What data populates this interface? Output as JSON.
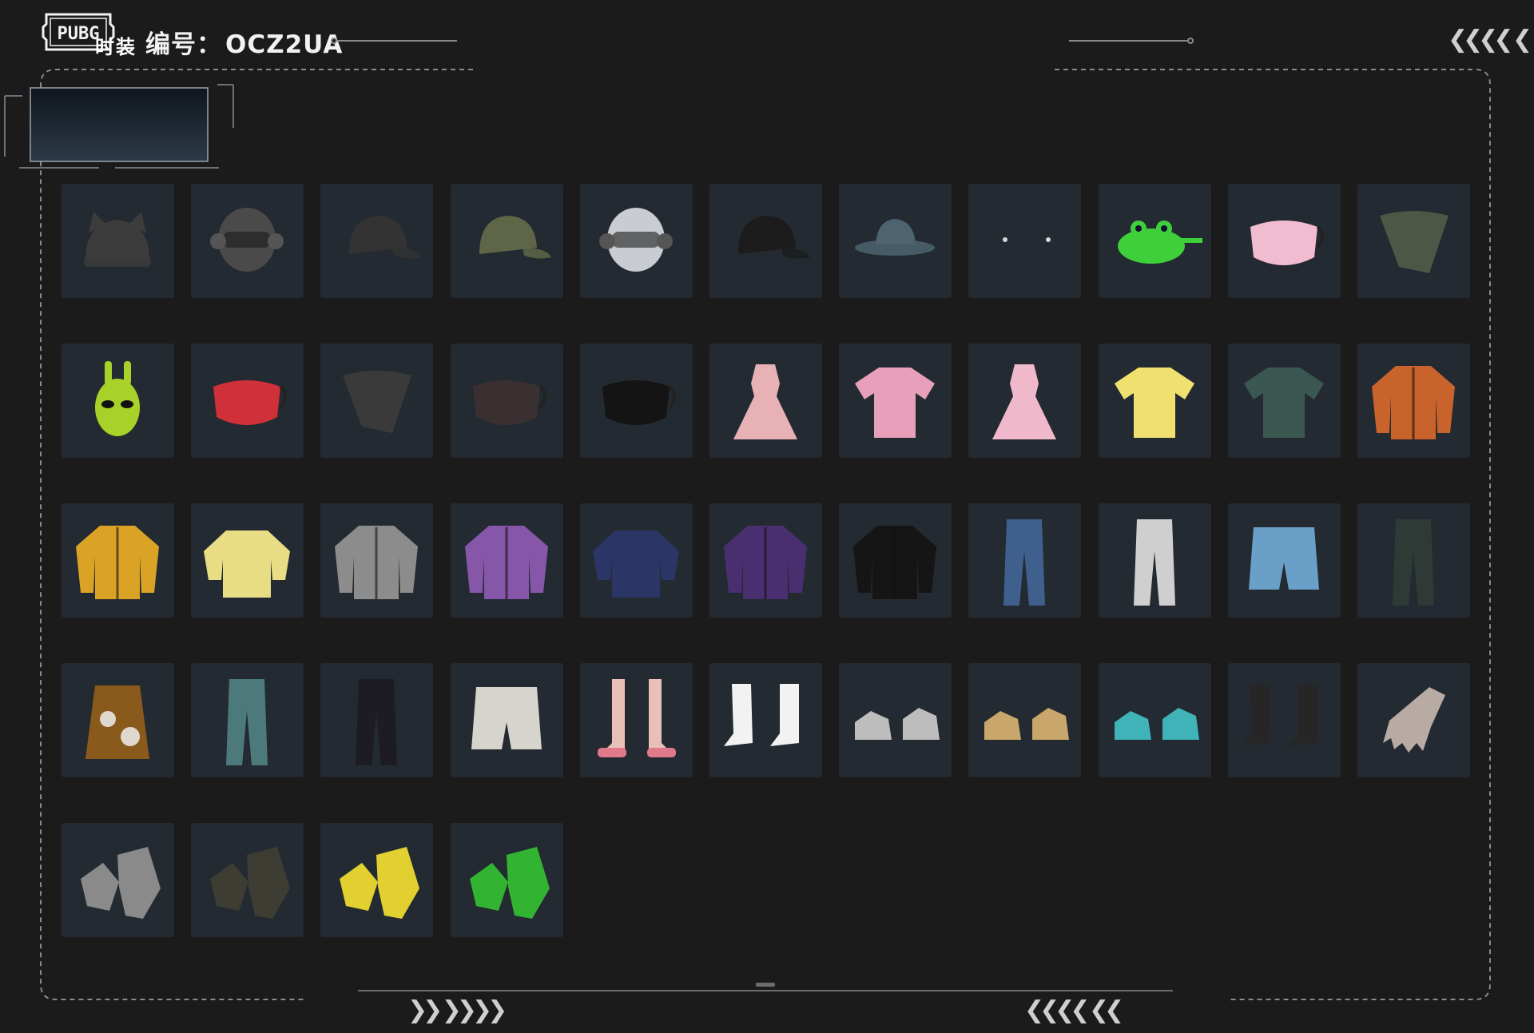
{
  "header": {
    "logo_text": "PUBG",
    "code_label": "编号：",
    "code_value": "OCZ2UA"
  },
  "tabs": [
    {
      "label": "时装",
      "active": true
    }
  ],
  "chevrons": {
    "top_right": "❮❮❮❮ ❮",
    "bottom_left": "❯❯ ❯❯❯❯",
    "bottom_right": "❮❮❮❮ ❮❮"
  },
  "colors": {
    "background": "#1b1b1c",
    "tile": "#232a31",
    "frame_line": "#8a8a8a",
    "text": "#ffffff"
  },
  "items": [
    {
      "name": "grey-cat-ear-beanie",
      "icon": "beanie-icon",
      "color": "#3c3c3c"
    },
    {
      "name": "headphones-dreadlocks-helmet",
      "icon": "helmet-icon",
      "color": "#4a4a4a"
    },
    {
      "name": "black-cap",
      "icon": "cap-icon",
      "color": "#333333"
    },
    {
      "name": "olive-cap-headset",
      "icon": "cap-icon",
      "color": "#5e6647"
    },
    {
      "name": "cyber-mask-helmet",
      "icon": "helmet-icon",
      "color": "#c9ccd0"
    },
    {
      "name": "black-logo-cap",
      "icon": "cap-icon",
      "color": "#1c1c1c"
    },
    {
      "name": "blue-bucket-hat",
      "icon": "hat-icon",
      "color": "#4d6470"
    },
    {
      "name": "eye-dots",
      "icon": "dots-icon",
      "color": "#d8d8d8"
    },
    {
      "name": "green-frog-mask",
      "icon": "frog-icon",
      "color": "#3fcf3a"
    },
    {
      "name": "pink-face-mask",
      "icon": "mask-icon",
      "color": "#f2bcd0"
    },
    {
      "name": "camo-bandana",
      "icon": "bandana-icon",
      "color": "#4c5746"
    },
    {
      "name": "green-alien-mask",
      "icon": "alien-icon",
      "color": "#a8d12a"
    },
    {
      "name": "red-mouth-mask",
      "icon": "mask-icon",
      "color": "#d0303a"
    },
    {
      "name": "grey-scarf",
      "icon": "bandana-icon",
      "color": "#3a3a3a"
    },
    {
      "name": "tactical-face-mask",
      "icon": "mask-icon",
      "color": "#3a3032"
    },
    {
      "name": "shark-teeth-mask",
      "icon": "mask-icon",
      "color": "#141414"
    },
    {
      "name": "pink-ruffle-dress",
      "icon": "dress-icon",
      "color": "#e7b1b6"
    },
    {
      "name": "pink-camo-tee",
      "icon": "shirt-icon",
      "color": "#e8a0ba"
    },
    {
      "name": "pink-qipao-dress",
      "icon": "dress-icon",
      "color": "#f0b8cb"
    },
    {
      "name": "yellow-raglan-tee",
      "icon": "shirt-icon",
      "color": "#f0e070"
    },
    {
      "name": "floral-shirt",
      "icon": "shirt-icon",
      "color": "#3b5752"
    },
    {
      "name": "orange-tech-jacket",
      "icon": "jacket-icon",
      "color": "#c8632b"
    },
    {
      "name": "yellow-hoodie",
      "icon": "jacket-icon",
      "color": "#dba326"
    },
    {
      "name": "cream-fluffy-sweater",
      "icon": "sweater-icon",
      "color": "#e8dc85"
    },
    {
      "name": "grey-orange-jacket",
      "icon": "jacket-icon",
      "color": "#8c8c8c"
    },
    {
      "name": "purple-colorblock-jacket",
      "icon": "jacket-icon",
      "color": "#8656a8"
    },
    {
      "name": "navy-sash-sweater",
      "icon": "sweater-icon",
      "color": "#2c3666"
    },
    {
      "name": "black-purple-jacket",
      "icon": "jacket-icon",
      "color": "#4a2f70"
    },
    {
      "name": "black-hoodie",
      "icon": "jacket-icon",
      "color": "#151515"
    },
    {
      "name": "blue-jeans",
      "icon": "pants-icon",
      "color": "#3f5f8c"
    },
    {
      "name": "white-cargo-pants",
      "icon": "pants-icon",
      "color": "#cfcfcf"
    },
    {
      "name": "denim-shorts",
      "icon": "shorts-icon",
      "color": "#6aa0c8"
    },
    {
      "name": "tactical-pants",
      "icon": "pants-icon",
      "color": "#2f3a36"
    },
    {
      "name": "cow-print-skirt",
      "icon": "skirt-icon",
      "color": "#8a5a1c"
    },
    {
      "name": "teal-shorts-leggings",
      "icon": "pants-icon",
      "color": "#4c7a7a"
    },
    {
      "name": "black-track-pants",
      "icon": "pants-icon",
      "color": "#1c1c22"
    },
    {
      "name": "white-shorts",
      "icon": "shorts-icon",
      "color": "#d6d4cc"
    },
    {
      "name": "pink-strap-shoes",
      "icon": "legs-icon",
      "color": "#e07a8a"
    },
    {
      "name": "white-boots",
      "icon": "boots-icon",
      "color": "#f2f2f2"
    },
    {
      "name": "white-sneakers",
      "icon": "shoes-icon",
      "color": "#bdbdbd"
    },
    {
      "name": "tan-boots",
      "icon": "shoes-icon",
      "color": "#c9a66b"
    },
    {
      "name": "teal-clogs",
      "icon": "shoes-icon",
      "color": "#3fb3b8"
    },
    {
      "name": "black-fur-boots",
      "icon": "boots-icon",
      "color": "#262626"
    },
    {
      "name": "bare-hand",
      "icon": "hand-icon",
      "color": "#b7aba4"
    },
    {
      "name": "grey-wristbands",
      "icon": "glove-icon",
      "color": "#8a8a8a"
    },
    {
      "name": "dark-tactical-gloves",
      "icon": "glove-icon",
      "color": "#3d3d34"
    },
    {
      "name": "yellow-cyber-gloves",
      "icon": "glove-icon",
      "color": "#e2d030"
    },
    {
      "name": "green-gloves",
      "icon": "glove-icon",
      "color": "#32b432"
    }
  ]
}
